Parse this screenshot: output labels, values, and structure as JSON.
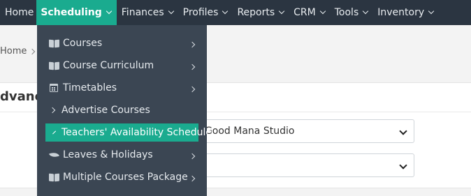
{
  "nav": {
    "items": [
      {
        "label": "Home",
        "has_caret": false,
        "active": false
      },
      {
        "label": "Scheduling",
        "has_caret": true,
        "active": true
      },
      {
        "label": "Finances",
        "has_caret": true,
        "active": false
      },
      {
        "label": "Profiles",
        "has_caret": true,
        "active": false
      },
      {
        "label": "Reports",
        "has_caret": true,
        "active": false
      },
      {
        "label": "CRM",
        "has_caret": true,
        "active": false
      },
      {
        "label": "Tools",
        "has_caret": true,
        "active": false
      },
      {
        "label": "Inventory",
        "has_caret": true,
        "active": false
      }
    ],
    "active_color": "#1aab8f",
    "bar_color": "#2b3541"
  },
  "breadcrumb": {
    "home": "Home"
  },
  "card": {
    "title": "dvance",
    "studio_select_value": "t Good Mana Studio",
    "second_select_value": ")"
  },
  "dropdown": {
    "items": [
      {
        "label": "Courses",
        "icon": "book-icon",
        "submenu": true
      },
      {
        "label": "Course Curriculum",
        "icon": "book-icon",
        "submenu": true
      },
      {
        "label": "Timetables",
        "icon": "calendar-icon",
        "submenu": true
      },
      {
        "label": "Advertise Courses",
        "icon": "chevron-right-icon",
        "submenu": false
      },
      {
        "label": "Teachers' Availability Schedule",
        "icon": "chevron-right-icon",
        "submenu": false,
        "active": true
      },
      {
        "label": "Leaves & Holidays",
        "icon": "leaf-icon",
        "submenu": true
      },
      {
        "label": "Multiple Courses Package",
        "icon": "book-icon",
        "submenu": true
      }
    ],
    "bg_color": "#3b4653"
  }
}
